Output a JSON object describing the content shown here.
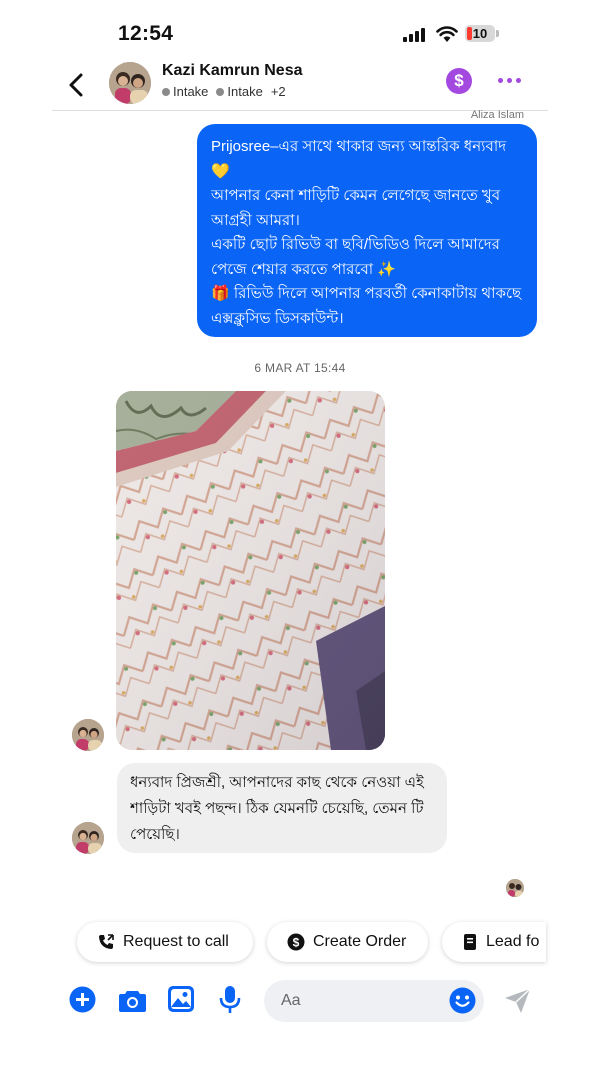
{
  "status_bar": {
    "time": "12:54",
    "battery": "10"
  },
  "header": {
    "name": "Kazi Kamrun Nesa",
    "tags": [
      "Intake",
      "Intake"
    ],
    "extra_tags": "+2"
  },
  "thread": {
    "sender_label": "Aliza Islam",
    "outgoing_lines": [
      "Prijosree–এর সাথে থাকার জন্য আন্তরিক ধন্যবাদ",
      "💛",
      "আপনার কেনা শাড়িটি কেমন লেগেছে জানতে খুব",
      "আগ্রহী আমরা।",
      "একটি ছোট রিভিউ বা ছবি/ভিডিও দিলে আমাদের",
      "পেজে শেয়ার করতে পারবো ✨",
      "🎁 রিভিউ দিলে আপনার পরবর্তী কেনাকাটায় থাকছে",
      "এক্সক্লুসিভ ডিসকাউন্ট।"
    ],
    "timestamp": "6 MAR AT 15:44",
    "incoming_lines": [
      "ধন্যবাদ প্রিজশ্রী, আপনাদের কাছ থেকে নেওয়া এই",
      "শাড়িটা খবই পছন্দ। ঠিক যেমনটি  চেয়েছি, তেমন টি",
      "পেয়েছি।"
    ]
  },
  "quick_actions": [
    "Request to call",
    "Create Order",
    "Lead fo"
  ],
  "composer": {
    "placeholder": "Aa"
  },
  "colors": {
    "accent": "#0a64f5",
    "purple": "#a349e0",
    "incoming_bubble": "#efefef"
  }
}
